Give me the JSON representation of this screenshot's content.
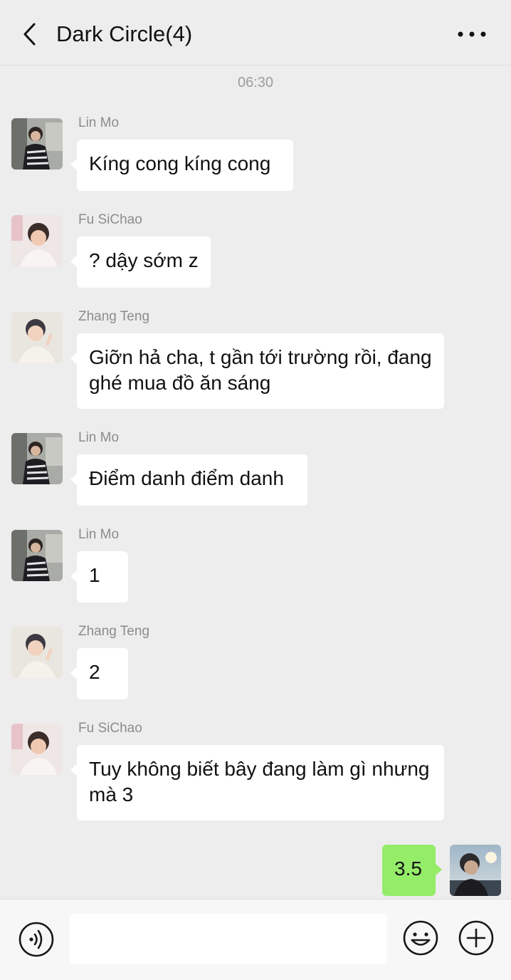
{
  "header": {
    "title": "Dark Circle(4)",
    "back_icon": "chevron-left-icon",
    "more_icon": "more-dots-icon"
  },
  "chat": {
    "timestamp": "06:30",
    "messages": [
      {
        "sender": "Lin Mo",
        "text": "Kíng cong kíng cong"
      },
      {
        "sender": "Fu SiChao",
        "text": "? dậy sớm z"
      },
      {
        "sender": "Zhang Teng",
        "text": "Giỡn hả cha, t gần tới trường rồi, đang ghé mua đồ ăn sáng"
      },
      {
        "sender": "Lin Mo",
        "text": "Điểm danh điểm danh"
      },
      {
        "sender": "Lin Mo",
        "text": "1"
      },
      {
        "sender": "Zhang Teng",
        "text": "2"
      },
      {
        "sender": "Fu SiChao",
        "text": "Tuy không biết bây đang làm gì nhưng mà 3"
      },
      {
        "sender": "",
        "text": "3.5",
        "mine": true
      }
    ]
  },
  "input_bar": {
    "voice_icon": "voice-icon",
    "emoji_icon": "emoji-icon",
    "plus_icon": "plus-icon",
    "placeholder": ""
  },
  "colors": {
    "background": "#ededed",
    "bubble_incoming": "#ffffff",
    "bubble_outgoing": "#95ec69",
    "sender_text": "#8c8c8c"
  }
}
